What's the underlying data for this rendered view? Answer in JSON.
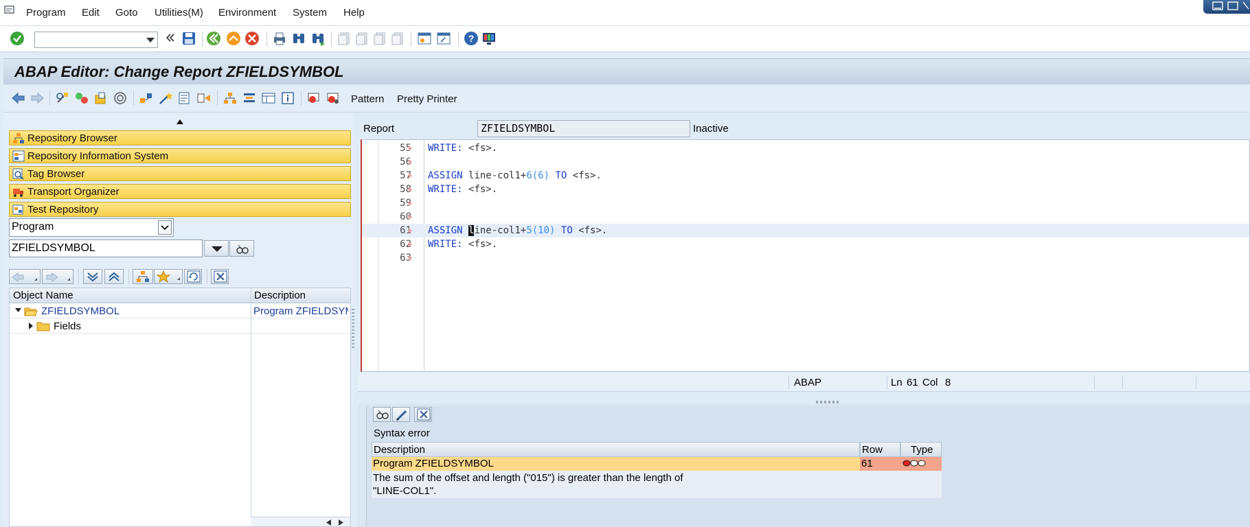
{
  "menubar": {
    "items": [
      "Program",
      "Edit",
      "Goto",
      "Utilities(M)",
      "Environment",
      "System",
      "Help"
    ]
  },
  "system_toolbar": {
    "command_field_value": ""
  },
  "title": "ABAP Editor: Change Report ZFIELDSYMBOL",
  "app_toolbar": {
    "pattern_label": "Pattern",
    "pretty_printer_label": "Pretty Printer"
  },
  "navigator": {
    "bars": [
      {
        "label": "Repository Browser",
        "icon": "hierarchy-icon"
      },
      {
        "label": "Repository Information System",
        "icon": "info-system-icon"
      },
      {
        "label": "Tag Browser",
        "icon": "tag-search-icon"
      },
      {
        "label": "Transport Organizer",
        "icon": "truck-icon"
      },
      {
        "label": "Test Repository",
        "icon": "test-icon"
      }
    ],
    "object_type": "Program",
    "object_name": "ZFIELDSYMBOL",
    "tree": {
      "columns": [
        "Object Name",
        "Description"
      ],
      "rows": [
        {
          "name": "ZFIELDSYMBOL",
          "description": "Program ZFIELDSYMB"
        },
        {
          "name": "Fields",
          "description": ""
        }
      ]
    }
  },
  "editor": {
    "report_label": "Report",
    "report_value": "ZFIELDSYMBOL",
    "status": "Inactive",
    "lines": [
      {
        "num": "55",
        "code": "WRITE: <fs>."
      },
      {
        "num": "56",
        "code": ""
      },
      {
        "num": "57",
        "code": "ASSIGN line-col1+6(6) TO <fs>."
      },
      {
        "num": "58",
        "code": "WRITE: <fs>."
      },
      {
        "num": "59",
        "code": ""
      },
      {
        "num": "60",
        "code": ""
      },
      {
        "num": "61",
        "code": "ASSIGN line-col1+5(10) TO <fs>."
      },
      {
        "num": "62",
        "code": "WRITE: <fs>."
      },
      {
        "num": "63",
        "code": ""
      }
    ],
    "language": "ABAP",
    "ln_label": "Ln",
    "ln_value": "61",
    "col_label": "Col",
    "col_value": "8"
  },
  "error_panel": {
    "heading": "Syntax error",
    "columns": [
      "Description",
      "Row",
      "Type"
    ],
    "row": {
      "description": "Program ZFIELDSYMBOL",
      "row": "61",
      "message_line1": "The sum of the offset and length (\"015\") is greater than the length of",
      "message_line2": "\"LINE-COL1\"."
    }
  },
  "colors": {
    "nav_bar": "#f7d24a",
    "error_row": "#fdd98a",
    "error_row_cell": "#f4a48c",
    "keyword": "#1a3cc8",
    "number": "#3a8ee6",
    "current_line": "#e6eef9"
  }
}
